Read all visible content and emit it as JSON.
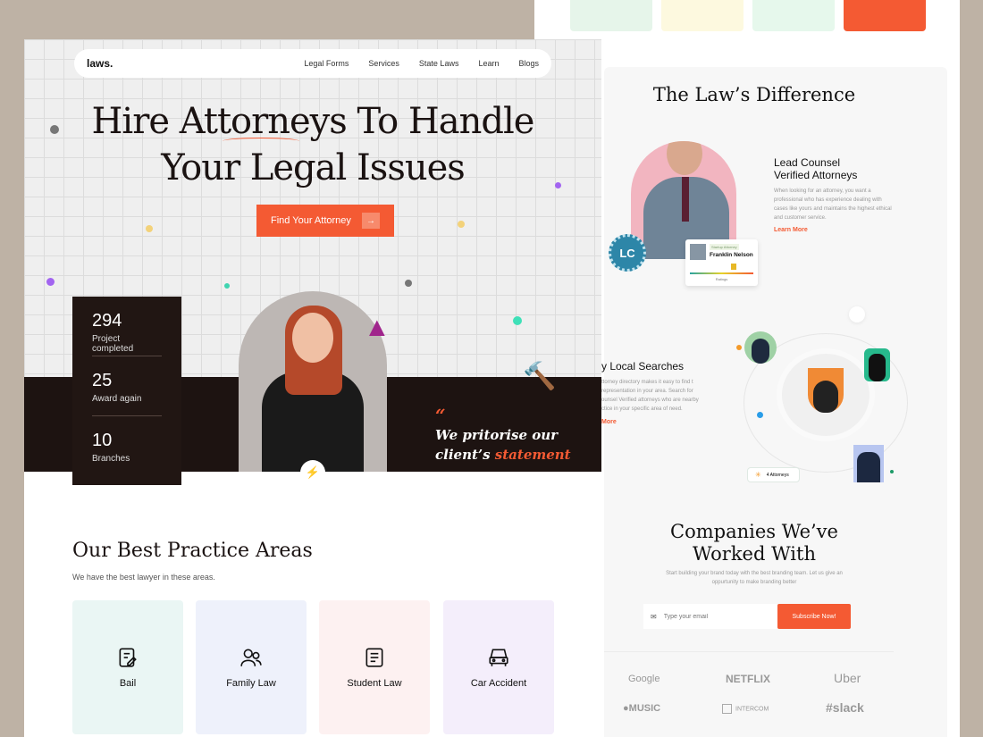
{
  "colors": {
    "accent": "#f45a33",
    "dark": "#1d1311",
    "background": "#beb2a5"
  },
  "nav": {
    "logo": "laws.",
    "links": [
      "Legal Forms",
      "Services",
      "State Laws",
      "Learn",
      "Blogs"
    ]
  },
  "hero": {
    "title_line1": "Hire Attorneys To Handle",
    "title_line2": "Your Legal Issues",
    "cta": "Find Your Attorney",
    "cta_icon": "arrow-right-icon"
  },
  "stats": [
    {
      "value": "294",
      "label": "Project completed"
    },
    {
      "value": "25",
      "label": "Award again"
    },
    {
      "value": "10",
      "label": "Branches"
    }
  ],
  "quote": {
    "mark": "“",
    "text1": "We pritorise our",
    "text2": "client’s ",
    "highlight": "statement"
  },
  "practice": {
    "title": "Our Best Practice Areas",
    "subtitle": "We have the best lawyer in these areas.",
    "cards": [
      {
        "label": "Bail",
        "icon": "document-pen-icon",
        "color": "#eaf6f4"
      },
      {
        "label": "Family Law",
        "icon": "users-icon",
        "color": "#eef1fb"
      },
      {
        "label": "Student Law",
        "icon": "document-icon",
        "color": "#fdf1f1"
      },
      {
        "label": "Car Accident",
        "icon": "car-icon",
        "color": "#f4eefb"
      }
    ]
  },
  "difference": {
    "title": "The Law’s Difference",
    "lead": {
      "title1": "Lead Counsel",
      "title2": "Verified Attorneys",
      "text": "When looking for an attorney, you want a professional who has experience dealing with cases like yours and maintains the highest ethical and customer service.",
      "link": "Learn More"
    },
    "profile": {
      "tag": "Startup Attorney",
      "name": "Franklin Nelson",
      "rating_label": "Ratings",
      "badge": "LC"
    },
    "local": {
      "title": "y Local Searches",
      "text": "ttorney directory makes it easy to find t representation in your area. Search for ounsel Verified attorneys who are nearby ctice in your specific area of need.",
      "link": "More"
    },
    "attorneys_badge": "4 Attorneys"
  },
  "companies": {
    "title1": "Companies We’ve",
    "title2": "Worked With",
    "text": "Start building your brand today with the best branding team. Let us give an oppurtunity to make branding better",
    "email_placeholder": "Type your email",
    "subscribe": "Subscribe Now!",
    "logos": [
      "Google",
      "NETFLIX",
      "Uber",
      "MUSIC",
      "INTERCOM",
      "slack"
    ]
  }
}
